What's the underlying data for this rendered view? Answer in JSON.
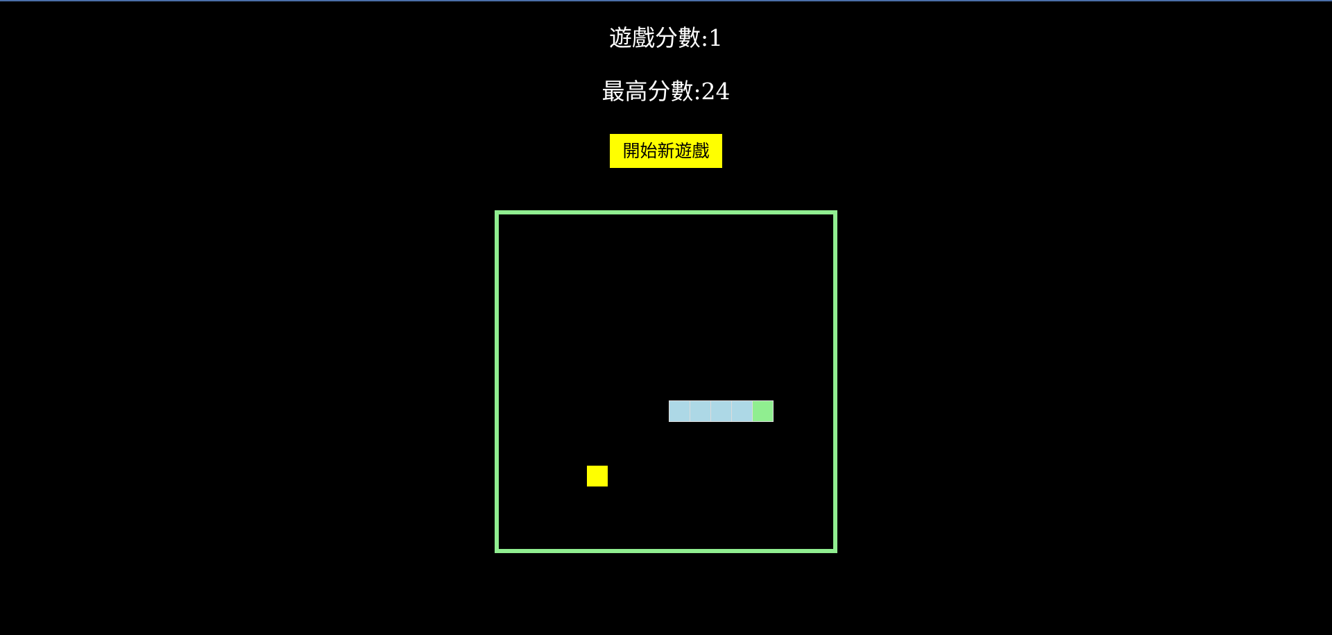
{
  "game": {
    "score_label": "遊戲分數:1",
    "high_score_label": "最高分數:24",
    "new_game_button": "開始新遊戲"
  },
  "colors": {
    "background": "#000000",
    "board_border": "#90ee90",
    "snake_body": "#add8e6",
    "snake_head": "#90ee90",
    "food": "#ffff00",
    "button_bg": "#ffff00"
  }
}
